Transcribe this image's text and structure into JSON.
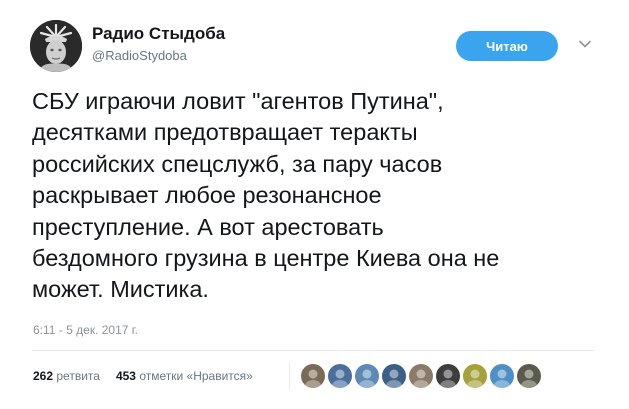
{
  "author": {
    "display_name": "Радио Стыдоба",
    "handle": "@RadioStydoba"
  },
  "follow_button": {
    "label": "Читаю"
  },
  "tweet": {
    "text": "СБУ играючи ловит \"агентов Путина\",\nдесятками предотвращает теракты\nроссийских спецслужб, за пару часов\nраскрывает любое резонансное\nпреступление. А вот арестовать\nбездомного грузина в центре Киева она не\nможет. Мистика.",
    "timestamp": "6:11 - 5 дек. 2017 г."
  },
  "stats": {
    "retweets_count": "262",
    "retweets_label": "ретвита",
    "likes_count": "453",
    "likes_label": "отметки «Нравится»"
  },
  "liker_avatars": [
    {
      "color": "#7b6a55"
    },
    {
      "color": "#4a6f9c"
    },
    {
      "color": "#5c8ab5"
    },
    {
      "color": "#3b5f86"
    },
    {
      "color": "#8a7a6a"
    },
    {
      "color": "#3d3d3d"
    },
    {
      "color": "#a5a13c"
    },
    {
      "color": "#4e8fc4"
    },
    {
      "color": "#5b5b4a"
    }
  ],
  "colors": {
    "accent": "#3aa4ef",
    "secondary_text": "#657786"
  },
  "icons": {
    "menu": "chevron-down-icon"
  }
}
